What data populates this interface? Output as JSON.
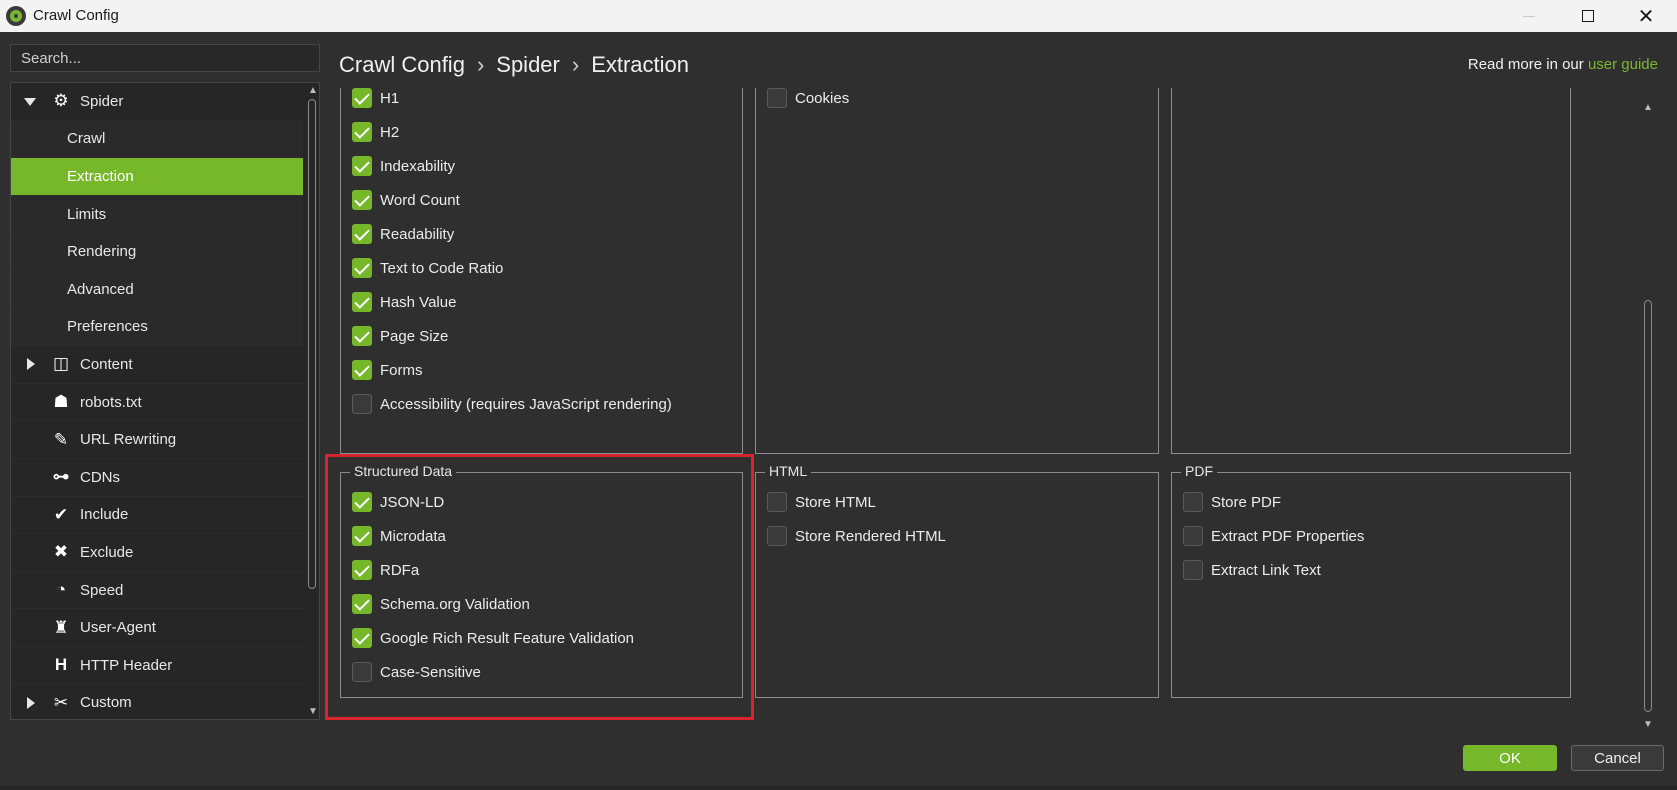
{
  "window": {
    "title": "Crawl Config",
    "minimize_icon": "minimize-icon",
    "maximize_icon": "maximize-icon",
    "close_icon": "close-icon"
  },
  "sidebar": {
    "search_placeholder": "Search...",
    "items": [
      {
        "label": "Spider",
        "icon": "gear-icon",
        "expanded": true,
        "level": 0
      },
      {
        "label": "Crawl",
        "level": 1
      },
      {
        "label": "Extraction",
        "level": 1,
        "active": true
      },
      {
        "label": "Limits",
        "level": 1
      },
      {
        "label": "Rendering",
        "level": 1
      },
      {
        "label": "Advanced",
        "level": 1
      },
      {
        "label": "Preferences",
        "level": 1
      },
      {
        "label": "Content",
        "icon": "layout-icon",
        "expanded": false,
        "level": 0
      },
      {
        "label": "robots.txt",
        "icon": "robot-icon",
        "level": 0
      },
      {
        "label": "URL Rewriting",
        "icon": "edit-icon",
        "level": 0
      },
      {
        "label": "CDNs",
        "icon": "network-icon",
        "level": 0
      },
      {
        "label": "Include",
        "icon": "check-circle-icon",
        "level": 0
      },
      {
        "label": "Exclude",
        "icon": "x-circle-icon",
        "level": 0
      },
      {
        "label": "Speed",
        "icon": "speedometer-icon",
        "level": 0
      },
      {
        "label": "User-Agent",
        "icon": "user-agent-icon",
        "level": 0
      },
      {
        "label": "HTTP Header",
        "icon": "header-h-icon",
        "level": 0
      },
      {
        "label": "Custom",
        "icon": "tools-icon",
        "expanded": false,
        "level": 0
      }
    ]
  },
  "header": {
    "breadcrumb": [
      "Crawl Config",
      "Spider",
      "Extraction"
    ],
    "separator": "›",
    "help_prefix": "Read more in our ",
    "help_link": "user guide"
  },
  "groups": {
    "page_details": {
      "options": [
        {
          "label": "H1",
          "checked": true
        },
        {
          "label": "H2",
          "checked": true
        },
        {
          "label": "Indexability",
          "checked": true
        },
        {
          "label": "Word Count",
          "checked": true
        },
        {
          "label": "Readability",
          "checked": true
        },
        {
          "label": "Text to Code Ratio",
          "checked": true
        },
        {
          "label": "Hash Value",
          "checked": true
        },
        {
          "label": "Page Size",
          "checked": true
        },
        {
          "label": "Forms",
          "checked": true
        },
        {
          "label": "Accessibility (requires JavaScript rendering)",
          "checked": false
        }
      ]
    },
    "url_details": {
      "options": [
        {
          "label": "Cookies",
          "checked": false
        }
      ]
    },
    "structured_data": {
      "title": "Structured Data",
      "options": [
        {
          "label": "JSON-LD",
          "checked": true
        },
        {
          "label": "Microdata",
          "checked": true
        },
        {
          "label": "RDFa",
          "checked": true
        },
        {
          "label": "Schema.org Validation",
          "checked": true
        },
        {
          "label": "Google Rich Result Feature Validation",
          "checked": true
        },
        {
          "label": "Case-Sensitive",
          "checked": false
        }
      ]
    },
    "html": {
      "title": "HTML",
      "options": [
        {
          "label": "Store HTML",
          "checked": false
        },
        {
          "label": "Store Rendered HTML",
          "checked": false
        }
      ]
    },
    "pdf": {
      "title": "PDF",
      "options": [
        {
          "label": "Store PDF",
          "checked": false
        },
        {
          "label": "Extract PDF Properties",
          "checked": false
        },
        {
          "label": "Extract Link Text",
          "checked": false
        }
      ]
    }
  },
  "buttons": {
    "ok": "OK",
    "cancel": "Cancel"
  },
  "colors": {
    "accent": "#76b82a",
    "highlight": "#d8242a",
    "background": "#2f2f2f"
  }
}
